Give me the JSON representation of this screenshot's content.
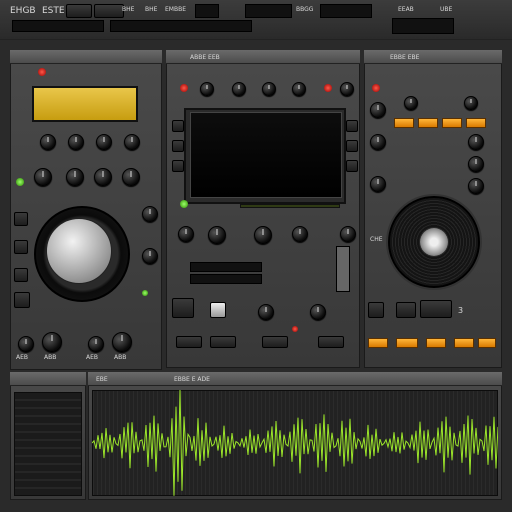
{
  "top_bar": {
    "labels": [
      "EHGB",
      "ESTE",
      "BHE",
      "BHE",
      "EMBBE",
      "BBGG",
      "EEAB",
      "UBE"
    ]
  },
  "left_module": {
    "display_text": "",
    "labels": [
      "AEB",
      "ABB",
      "AEB",
      "ABB"
    ]
  },
  "center_module": {
    "header_text": "ABBE EEB",
    "screen_text": ""
  },
  "right_module": {
    "header_text": "EBBE EBE",
    "side_label": "CHE",
    "footer_number": "3"
  },
  "waveform": {
    "title": "EBBE E ADE",
    "tag": "EBE",
    "color": "#9be52a"
  },
  "colors": {
    "accent_amber": "#ffb63a",
    "screen_yellow": "#e0b824",
    "led_red": "#ff3a2a",
    "led_green": "#7fe43a"
  }
}
